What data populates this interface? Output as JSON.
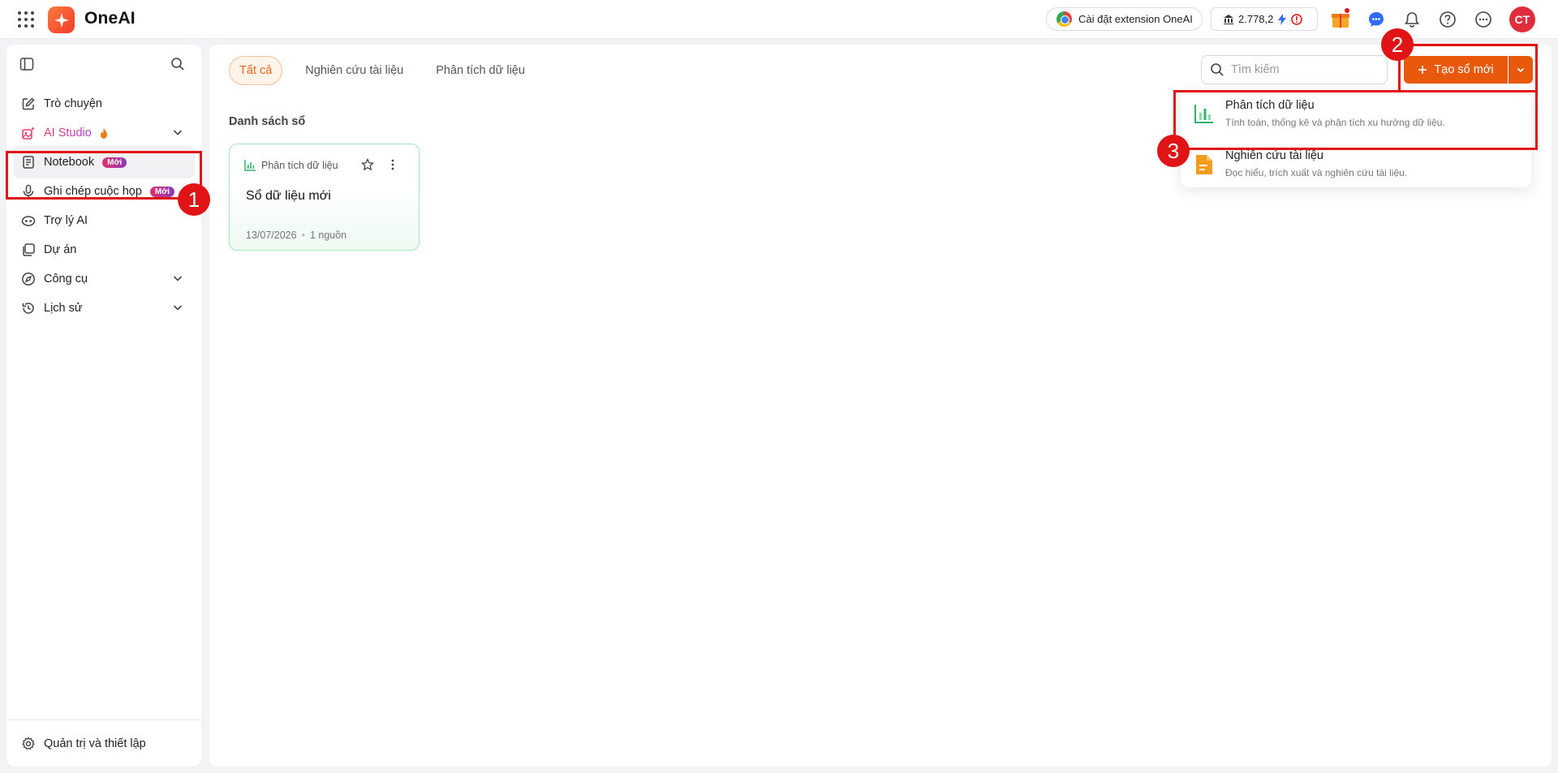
{
  "app": {
    "name": "OneAI"
  },
  "topbar": {
    "extension_label": "Cài đặt extension OneAI",
    "credits": "2.778,2",
    "avatar_initials": "CT"
  },
  "sidebar": {
    "items": [
      {
        "label": "Trò chuyện",
        "icon": "edit-icon"
      },
      {
        "label": "AI Studio",
        "icon": "ai-studio-icon"
      },
      {
        "label": "Notebook",
        "icon": "notebook-icon",
        "badge": "Mới"
      },
      {
        "label": "Ghi chép cuộc họp",
        "icon": "microphone-icon",
        "badge": "Mới"
      },
      {
        "label": "Trợ lý AI",
        "icon": "robot-icon"
      },
      {
        "label": "Dự án",
        "icon": "folders-icon"
      },
      {
        "label": "Công cụ",
        "icon": "compass-icon"
      },
      {
        "label": "Lịch sử",
        "icon": "history-icon"
      }
    ],
    "footer_label": "Quản trị và thiết lập"
  },
  "main": {
    "tabs": [
      {
        "label": "Tất cả"
      },
      {
        "label": "Nghiên cứu tài liệu"
      },
      {
        "label": "Phân tích dữ liệu"
      }
    ],
    "search_placeholder": "Tìm kiếm",
    "create_button": "Tạo sổ mới",
    "section_title": "Danh sách sổ",
    "notebooks": [
      {
        "type": "Phân tích dữ liệu",
        "title": "Sổ dữ liệu mới",
        "date": "13/07/2026",
        "sources": "1 nguồn"
      }
    ],
    "dropdown": [
      {
        "title": "Phân tích dữ liệu",
        "subtitle": "Tính toán, thống kê và phân tích xu hướng dữ liệu."
      },
      {
        "title": "Nghiên cứu tài liệu",
        "subtitle": "Đọc hiểu, trích xuất và nghiên cứu tài liệu."
      }
    ]
  },
  "annotations": {
    "step1": "1",
    "step2": "2",
    "step3": "3"
  },
  "colors": {
    "accent": "#e8590c",
    "highlight": "#e01414",
    "data_green": "#2fb36b",
    "doc_orange": "#f29b1d"
  }
}
